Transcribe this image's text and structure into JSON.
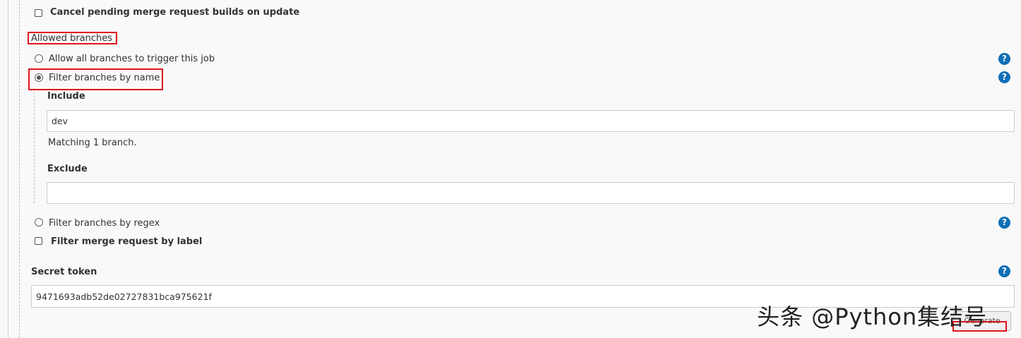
{
  "cancel_pending": {
    "label": "Cancel pending merge request builds on update",
    "checked": false
  },
  "allowed_branches": {
    "heading": "Allowed branches",
    "options": [
      {
        "label": "Allow all branches to trigger this job",
        "selected": false
      },
      {
        "label": "Filter branches by name",
        "selected": true
      },
      {
        "label": "Filter branches by regex",
        "selected": false
      }
    ],
    "include": {
      "label": "Include",
      "value": "dev",
      "hint": "Matching 1 branch."
    },
    "exclude": {
      "label": "Exclude",
      "value": ""
    }
  },
  "filter_label": {
    "label": "Filter merge request by label",
    "checked": false
  },
  "secret_token": {
    "label": "Secret token",
    "value": "9471693adb52de02727831bca975621f",
    "generate_button": "Generate"
  },
  "help_icon_glyph": "?",
  "watermark": "头条 @Python集结号",
  "colors": {
    "help_icon": "#0e6fb5",
    "highlight_box": "#e0151b",
    "background": "#f9f9f9"
  }
}
